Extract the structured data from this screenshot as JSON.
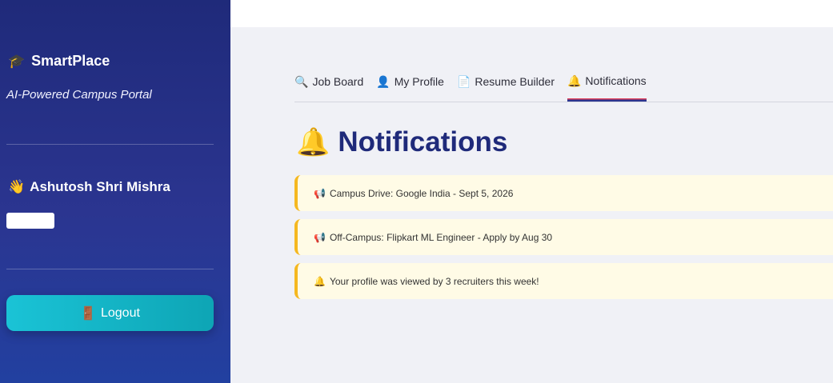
{
  "sidebar": {
    "brand_icon": "🎓",
    "brand": "SmartPlace",
    "tagline": "AI-Powered Campus Portal",
    "user_icon": "👋",
    "user_name": "Ashutosh Shri Mishra",
    "logout_icon": "🚪",
    "logout_label": "Logout"
  },
  "tabs": [
    {
      "icon": "🔍",
      "label": "Job Board"
    },
    {
      "icon": "👤",
      "label": "My Profile"
    },
    {
      "icon": "📄",
      "label": "Resume Builder"
    },
    {
      "icon": "🔔",
      "label": "Notifications"
    }
  ],
  "main": {
    "title_icon": "🔔",
    "title": "Notifications"
  },
  "notifications": [
    {
      "icon": "📢",
      "text": "Campus Drive: Google India - Sept 5, 2026"
    },
    {
      "icon": "📢",
      "text": "Off-Campus: Flipkart ML Engineer - Apply by Aug 30"
    },
    {
      "icon": "🔔",
      "text": "Your profile was viewed by 3 recruiters this week!"
    }
  ],
  "colors": {
    "sidebar": "#2b3590",
    "accent": "#1f2a7a",
    "logout": "#1ac3d6",
    "notif_bg": "#fffbe6",
    "notif_border": "#f5b820"
  }
}
